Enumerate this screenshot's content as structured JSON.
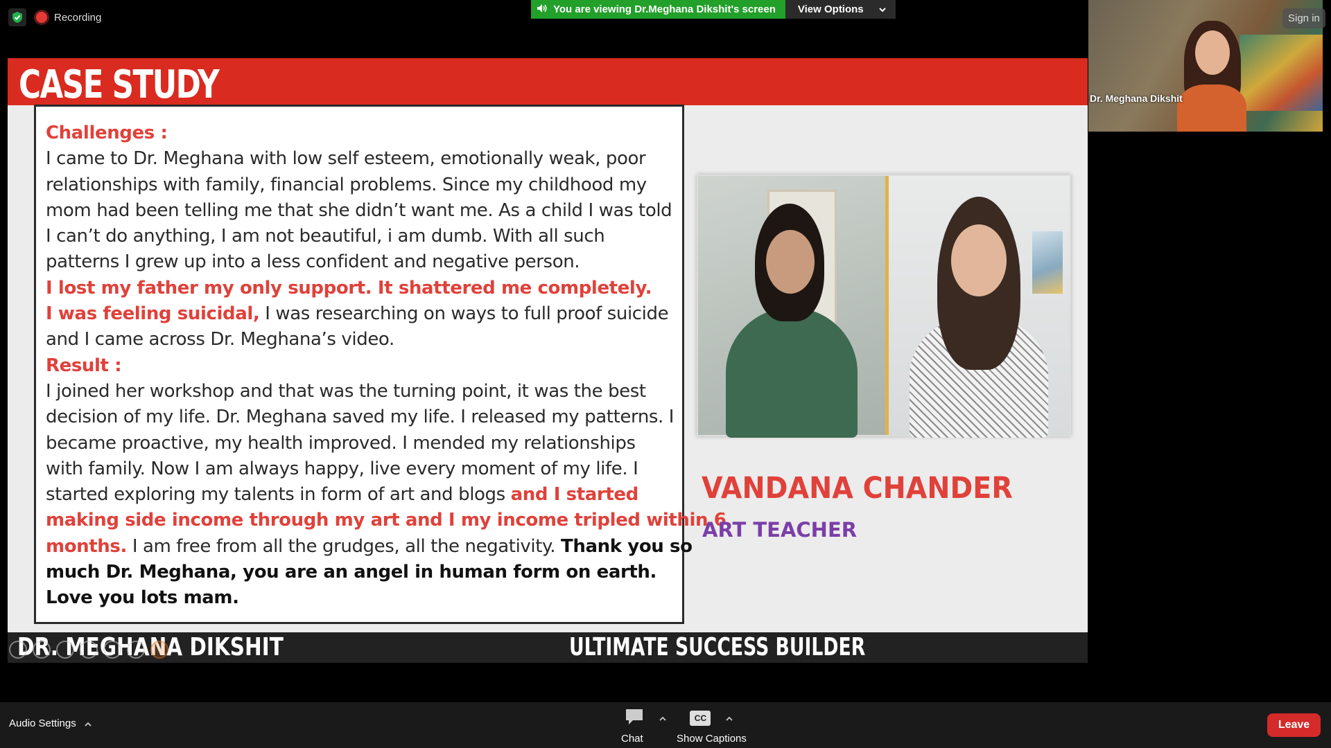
{
  "status": {
    "recording_label": "Recording"
  },
  "banner": {
    "viewing_text": "You are viewing Dr.Meghana Dikshit's screen",
    "view_options_label": "View Options"
  },
  "video": {
    "participant_name": "Dr. Meghana Dikshit",
    "sign_in_label": "Sign in"
  },
  "slide": {
    "title": "CASE STUDY",
    "challenges_heading": "Challenges :",
    "lines": {
      "l1": "I came to Dr. Meghana with low self esteem, emotionally weak, poor",
      "l2": "relationships with family, financial problems. Since my childhood my",
      "l3": "mom had been telling me that she didn’t want me. As a child I was told",
      "l4": "I can’t do anything, I am not beautiful, i am dumb. With all such",
      "l5": "patterns I grew up into a less confident and negative person.",
      "l6": "I lost my father my only support. It shattered me completely.",
      "l7a": "I was feeling suicidal,",
      "l7b": " I was researching on ways to full proof suicide",
      "l8": "and I came across Dr. Meghana’s video.",
      "l10": "I joined her workshop and that was the turning point, it was the best",
      "l11": "decision of my life. Dr. Meghana saved my life. I released my patterns. I",
      "l12": "became proactive, my health improved. I mended my relationships",
      "l13": "with family. Now I am always happy, live every moment of my life. I",
      "l14a": "started exploring my talents in form of art and blogs ",
      "l14b": "and I started",
      "l15": "making side income through my art and I my income tripled within 6",
      "l16a": "months.",
      "l16b": " I am free from all the grudges, all the negativity. ",
      "l16c": "Thank you so",
      "l17": "much Dr. Meghana, you are an angel in human form on earth.",
      "l18": "Love you lots mam."
    },
    "result_heading": "Result :",
    "person_name": "VANDANA CHANDER",
    "person_role": "ART TEACHER",
    "footer_left": "DR. MEGHANA DIKSHIT",
    "footer_center": "ULTIMATE SUCCESS BUILDER"
  },
  "toolbar": {
    "audio_settings_label": "Audio Settings",
    "chat_label": "Chat",
    "captions_label": "Show Captions",
    "cc_badge": "CC",
    "leave_label": "Leave"
  },
  "colors": {
    "banner_green": "#22a02a",
    "slide_red": "#d92b20",
    "leave_red": "#d42a2a",
    "role_purple": "#7b3fa8"
  }
}
